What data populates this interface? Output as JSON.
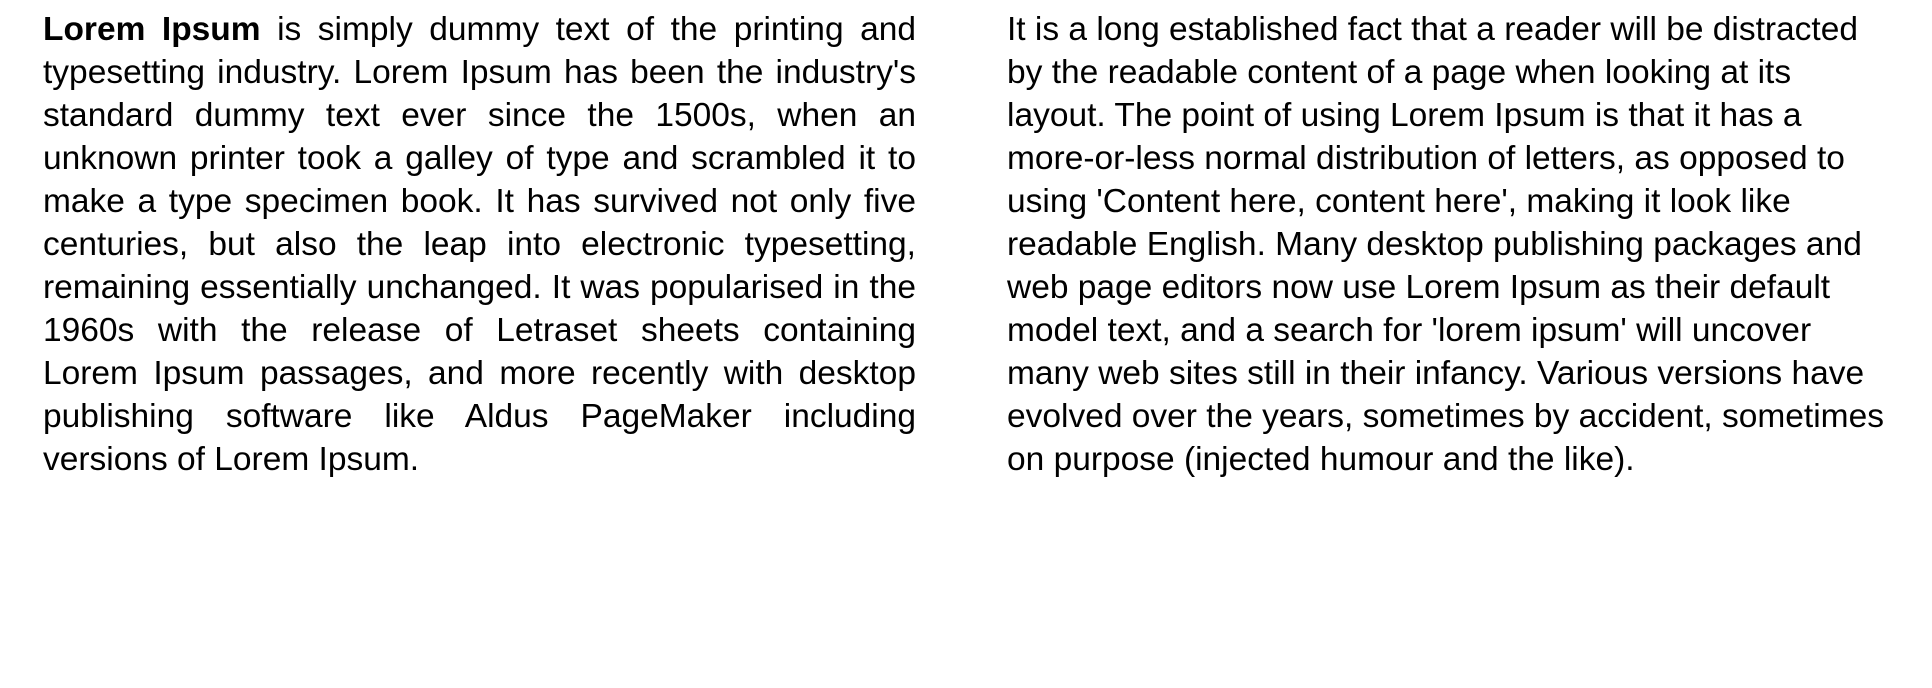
{
  "left_column": {
    "lead": "Lorem Ipsum",
    "body": " is simply dummy text of the printing and typesetting industry. Lorem Ipsum has been the industry's standard dummy text ever since the 1500s, when an unknown printer took a galley of type and scrambled it to make a type specimen book. It has survived not only five centuries, but also the leap into electronic typesetting, remaining essentially unchanged. It was popularised in the 1960s with the release of Letraset sheets containing Lorem Ipsum passages, and more recently with desktop publishing software like Aldus PageMaker including versions of Lorem Ipsum."
  },
  "right_column": {
    "body": "It is a long established fact that a reader will be distracted by the readable content of a page when looking at its layout. The point of using Lorem Ipsum is that it has a more-or-less normal distribution of letters, as opposed to using 'Content here, content here', making it look like readable English. Many desktop publishing packages and web page editors now use Lorem Ipsum as their default model text, and a search for 'lorem ipsum' will uncover many web sites still in their infancy. Various versions have evolved over the years, sometimes by accident, sometimes on purpose (injected humour and the like)."
  }
}
